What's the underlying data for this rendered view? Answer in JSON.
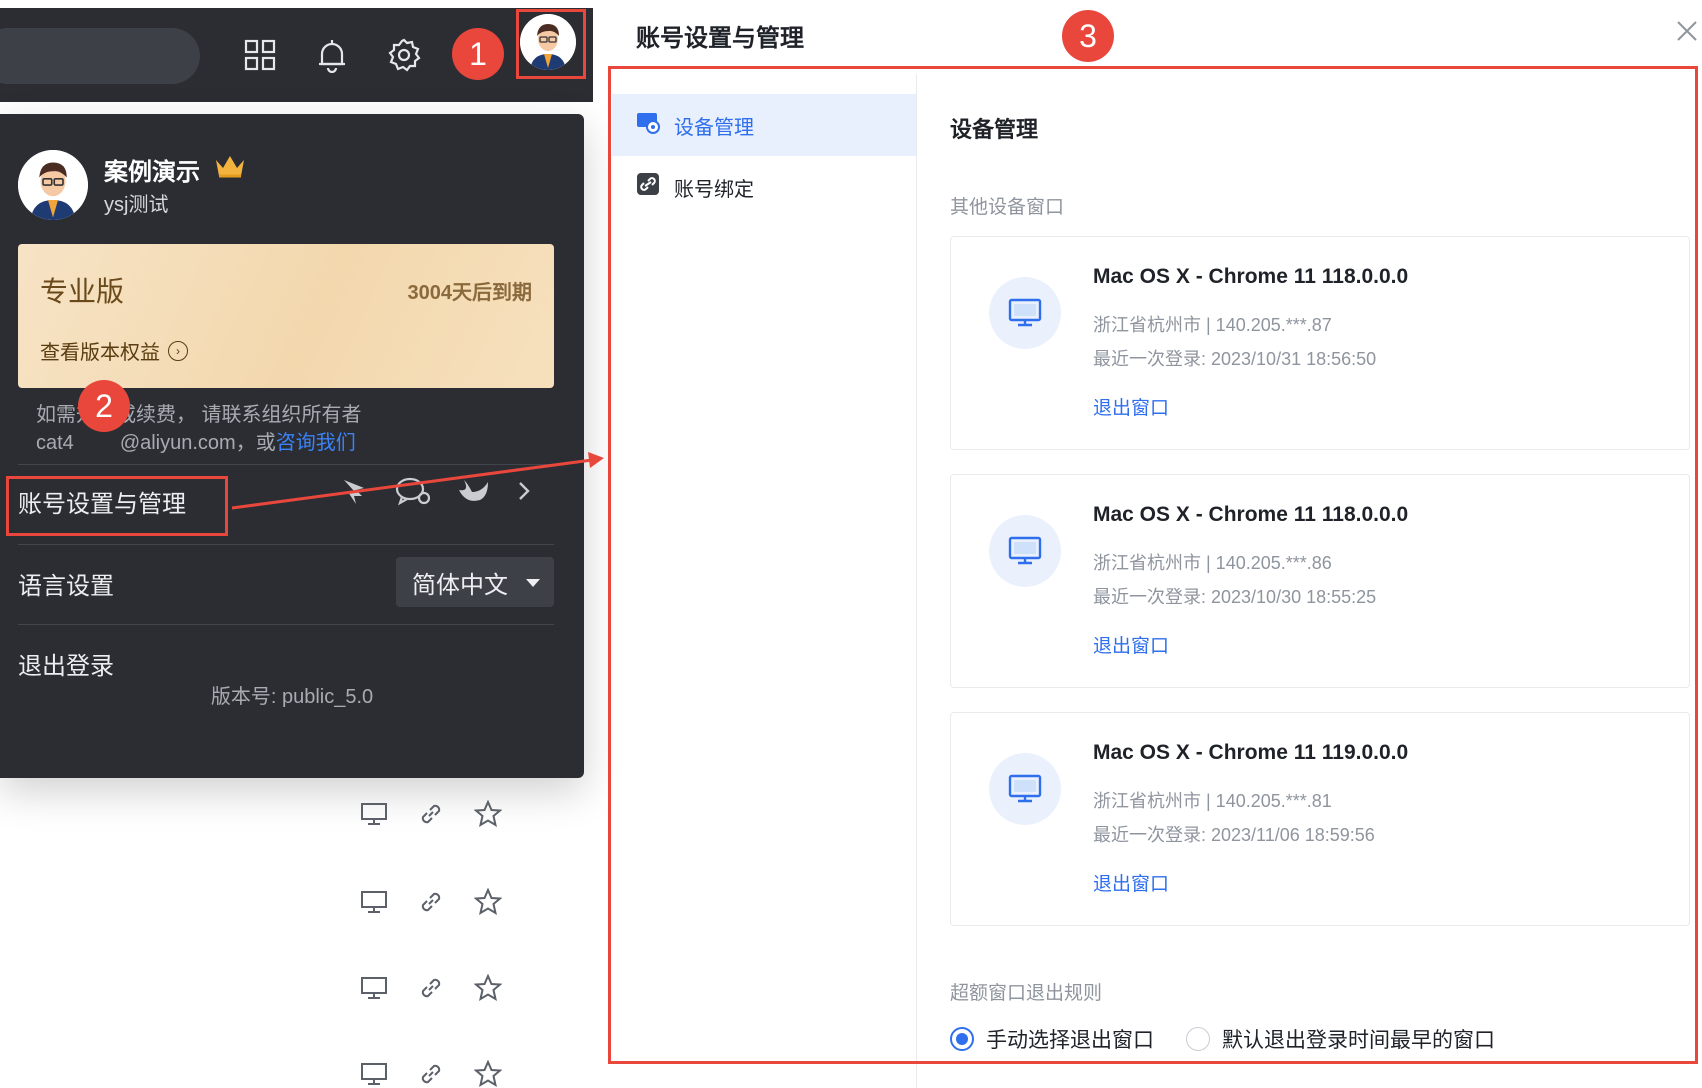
{
  "annotations": {
    "step1": "1",
    "step2": "2",
    "step3": "3"
  },
  "account_menu": {
    "user_name": "案例演示",
    "user_sub": "ysj测试",
    "plan_name": "专业版",
    "plan_expire": "3004天后到期",
    "plan_benefits_link": "查看版本权益",
    "note_line1": "如需升级或续费， 请联系组织所有者",
    "note_line2_prefix": "cat4",
    "note_line2_mid": "@aliyun.com，或",
    "note_line2_link": "咨询我们",
    "account_settings_label": "账号设置与管理",
    "language_label": "语言设置",
    "language_value": "简体中文",
    "logout_label": "退出登录",
    "version": "版本号:  public_5.0"
  },
  "dialog": {
    "title": "账号设置与管理",
    "nav": [
      {
        "label": "设备管理",
        "active": true,
        "icon": "device-settings-icon"
      },
      {
        "label": "账号绑定",
        "active": false,
        "icon": "link-icon"
      }
    ],
    "content_title": "设备管理",
    "other_devices_label": "其他设备窗口",
    "devices": [
      {
        "name": "Mac OS X - Chrome 11 118.0.0.0",
        "location": "浙江省杭州市 | 140.205.***.87",
        "last_login": "最近一次登录:   2023/10/31 18:56:50",
        "logout": "退出窗口"
      },
      {
        "name": "Mac OS X - Chrome 11 118.0.0.0",
        "location": "浙江省杭州市 | 140.205.***.86",
        "last_login": "最近一次登录:   2023/10/30 18:55:25",
        "logout": "退出窗口"
      },
      {
        "name": "Mac OS X - Chrome 11 119.0.0.0",
        "location": "浙江省杭州市 | 140.205.***.81",
        "last_login": "最近一次登录:   2023/11/06 18:59:56",
        "logout": "退出窗口"
      }
    ],
    "exceed_rule_label": "超额窗口退出规则",
    "exceed_options": [
      {
        "label": "手动选择退出窗口",
        "selected": true
      },
      {
        "label": "默认退出登录时间最早的窗口",
        "selected": false
      }
    ]
  },
  "colors": {
    "accent": "#2f6fed",
    "annotation_red": "#e9473c",
    "menu_bg": "#2b2d33"
  }
}
